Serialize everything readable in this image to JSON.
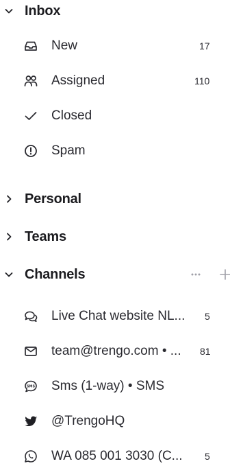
{
  "inbox": {
    "title": "Inbox",
    "items": [
      {
        "label": "New",
        "count": "17",
        "icon": "inbox-tray-icon"
      },
      {
        "label": "Assigned",
        "count": "110",
        "icon": "users-icon"
      },
      {
        "label": "Closed",
        "count": "",
        "icon": "check-icon"
      },
      {
        "label": "Spam",
        "count": "",
        "icon": "alert-circle-icon"
      }
    ]
  },
  "personal": {
    "title": "Personal"
  },
  "teams": {
    "title": "Teams"
  },
  "channels": {
    "title": "Channels",
    "items": [
      {
        "label": "Live Chat website NL...",
        "count": "5",
        "icon": "chat-bubbles-icon"
      },
      {
        "label": "team@trengo.com • ...",
        "count": "81",
        "icon": "mail-icon"
      },
      {
        "label": "Sms (1-way) • SMS",
        "count": "",
        "icon": "sms-bubble-icon"
      },
      {
        "label": "@TrengoHQ",
        "count": "",
        "icon": "twitter-icon"
      },
      {
        "label": "WA 085 001 3030 (C...",
        "count": "5",
        "icon": "whatsapp-icon"
      }
    ]
  }
}
